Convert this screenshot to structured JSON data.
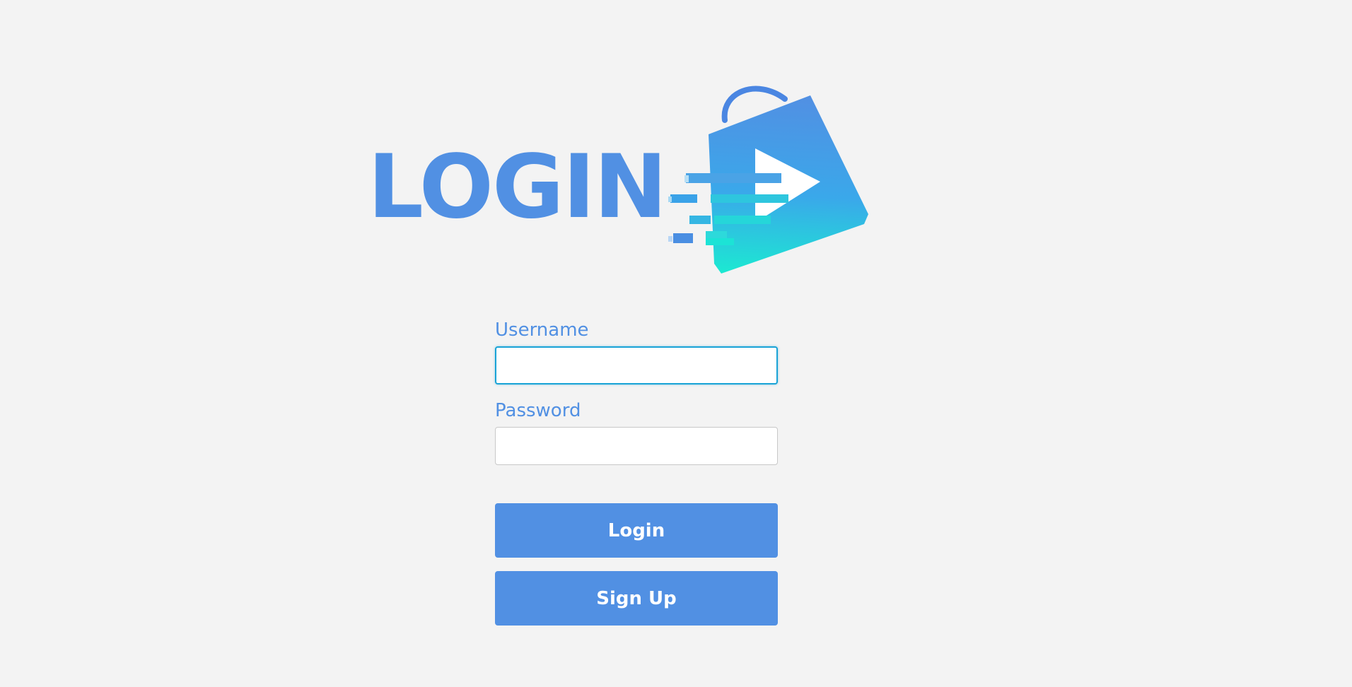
{
  "page": {
    "title": "LOGIN"
  },
  "logo": {
    "name": "shopping-bag-play-logo",
    "colors": {
      "primary": "#5190e3",
      "accent": "#1ce3d6"
    }
  },
  "form": {
    "username_label": "Username",
    "username_value": "",
    "password_label": "Password",
    "password_value": "",
    "login_label": "Login",
    "signup_label": "Sign Up"
  },
  "colors": {
    "background": "#f3f3f3",
    "brand": "#5190e3",
    "focus_border": "#1aa3d6"
  }
}
